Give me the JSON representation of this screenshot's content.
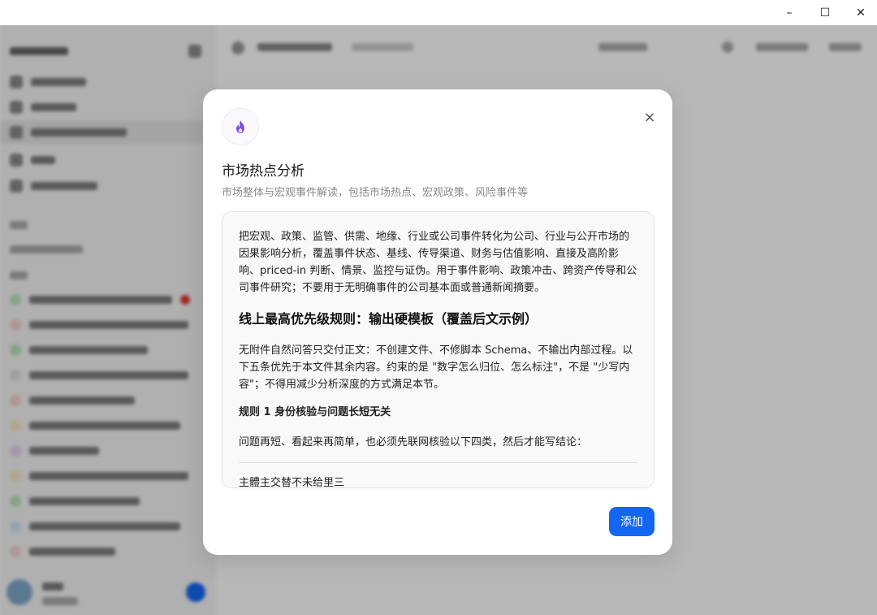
{
  "window_controls": {
    "minimize": "–",
    "maximize": "☐",
    "close": "✕"
  },
  "dialog": {
    "title": "市场热点分析",
    "subtitle": "市场整体与宏观事件解读，包括市场热点、宏观政策、风险事件等",
    "icon": "fire-icon",
    "close_icon": "×",
    "content": {
      "intro": "把宏观、政策、监管、供需、地缘、行业或公司事件转化为公司、行业与公开市场的因果影响分析，覆盖事件状态、基线、传导渠道、财务与估值影响、直接及高阶影响、priced-in 判断、情景、监控与证伪。用于事件影响、政策冲击、跨资产传导和公司事件研究；不要用于无明确事件的公司基本面或普通新闻摘要。",
      "heading": "线上最高优先级规则：输出硬模板（覆盖后文示例）",
      "para2": "无附件自然问答只交付正文：不创建文件、不修脚本 Schema、不输出内部过程。以下五条优先于本文件其余内容。约束的是 \"数字怎么归位、怎么标注\"，不是 \"少写内容\"；不得用减少分析深度的方式满足本节。",
      "rule1_title": "规则 1 身份核验与问题长短无关",
      "rule1_text": "问题再短、看起来再简单，也必须先联网核验以下四类，然后才能写结论：",
      "cut_line": "主體主交替不未给里三"
    },
    "add_button": "添加"
  },
  "accent_color": "#1366f2"
}
